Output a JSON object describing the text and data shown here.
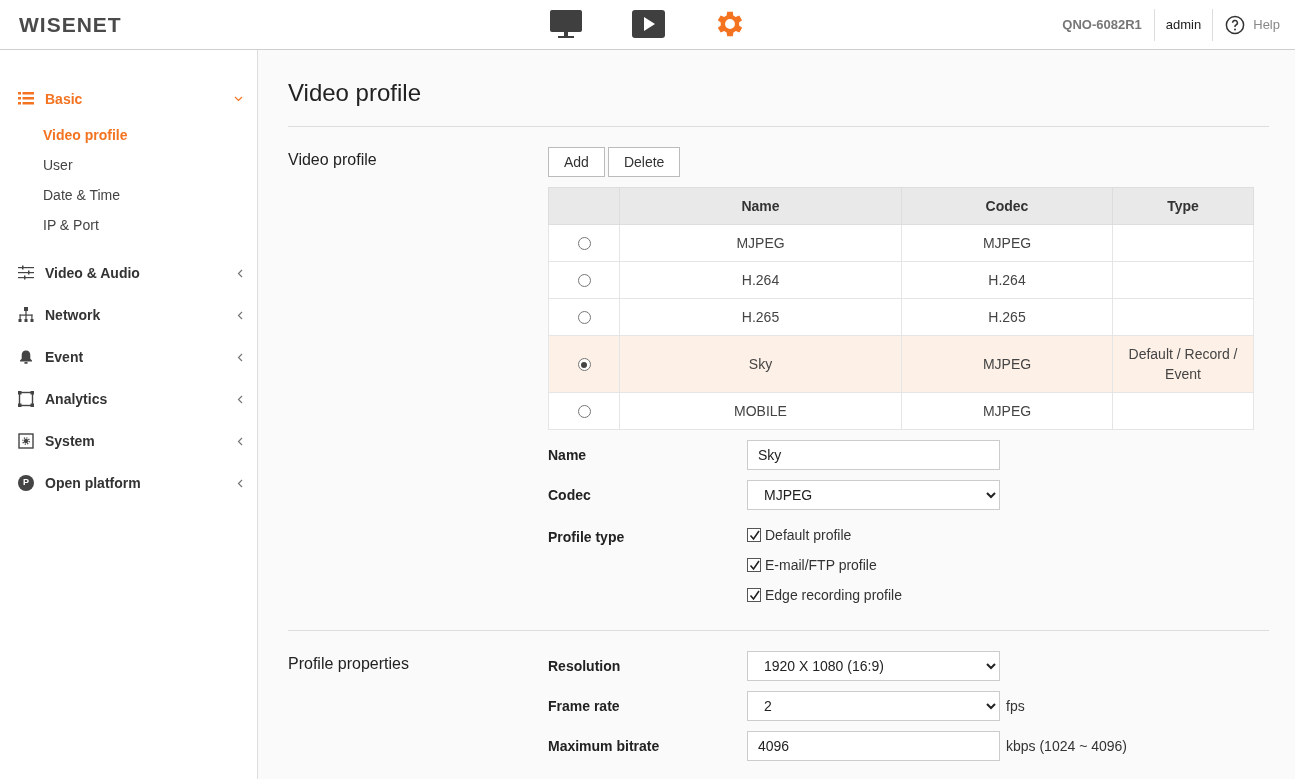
{
  "header": {
    "logo": "WISENET",
    "nav_icons": [
      {
        "kind": "monitor",
        "selected": false
      },
      {
        "kind": "play",
        "selected": false
      },
      {
        "kind": "gear",
        "selected": true
      }
    ],
    "model": "QNO-6082R1",
    "user": "admin",
    "help": "Help"
  },
  "sidebar": {
    "items": [
      {
        "label": "Basic",
        "kind": "list",
        "expanded": true,
        "selected": true,
        "children": [
          {
            "label": "Video profile",
            "selected": true
          },
          {
            "label": "User",
            "selected": false
          },
          {
            "label": "Date & Time",
            "selected": false
          },
          {
            "label": "IP & Port",
            "selected": false
          }
        ]
      },
      {
        "label": "Video & Audio",
        "kind": "sliders",
        "expanded": false,
        "selected": false
      },
      {
        "label": "Network",
        "kind": "network",
        "expanded": false,
        "selected": false
      },
      {
        "label": "Event",
        "kind": "bell",
        "expanded": false,
        "selected": false
      },
      {
        "label": "Analytics",
        "kind": "frame",
        "expanded": false,
        "selected": false
      },
      {
        "label": "System",
        "kind": "system",
        "expanded": false,
        "selected": false
      },
      {
        "label": "Open platform",
        "kind": "letter",
        "icon_letter": "P",
        "expanded": false,
        "selected": false
      }
    ]
  },
  "page_title": "Video profile",
  "sections": [
    {
      "label": "Video profile",
      "buttons": [
        "Add",
        "Delete"
      ],
      "table": {
        "columns": [
          "Name",
          "Codec",
          "Type"
        ],
        "rows": [
          {
            "selected": false,
            "cells": [
              "MJPEG",
              "MJPEG",
              ""
            ]
          },
          {
            "selected": false,
            "cells": [
              "H.264",
              "H.264",
              ""
            ]
          },
          {
            "selected": false,
            "cells": [
              "H.265",
              "H.265",
              ""
            ]
          },
          {
            "selected": true,
            "cells": [
              "Sky",
              "MJPEG",
              "Default / Record / Event"
            ]
          },
          {
            "selected": false,
            "cells": [
              "MOBILE",
              "MJPEG",
              ""
            ]
          }
        ]
      },
      "fields": [
        {
          "kind": "text",
          "label": "Name",
          "value": "Sky"
        },
        {
          "kind": "select",
          "label": "Codec",
          "value": "MJPEG"
        },
        {
          "kind": "checkboxes",
          "label": "Profile type",
          "options": [
            {
              "label": "Default profile",
              "checked": true
            },
            {
              "label": "E-mail/FTP profile",
              "checked": true
            },
            {
              "label": "Edge recording profile",
              "checked": true
            }
          ]
        }
      ]
    },
    {
      "label": "Profile properties",
      "fields": [
        {
          "kind": "select",
          "label": "Resolution",
          "value": "1920 X 1080 (16:9)"
        },
        {
          "kind": "select",
          "label": "Frame rate",
          "value": "2",
          "unit": "fps"
        },
        {
          "kind": "text",
          "label": "Maximum bitrate",
          "value": "4096",
          "unit": "kbps (1024 ~ 4096)"
        }
      ]
    }
  ]
}
